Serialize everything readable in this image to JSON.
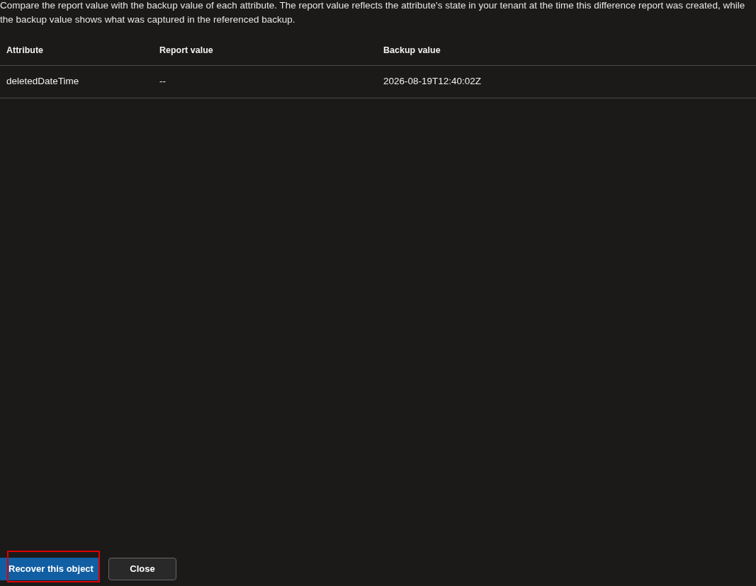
{
  "description": "Compare the report value with the backup value of each attribute. The report value reflects the attribute's state in your tenant at the time this difference report was created, while the backup value shows what was captured in the referenced backup.",
  "table": {
    "columns": [
      "Attribute",
      "Report value",
      "Backup value"
    ],
    "rows": [
      [
        "deletedDateTime",
        "--",
        "2026-08-19T12:40:02Z"
      ]
    ]
  },
  "buttons": [
    {
      "label": "Recover this object",
      "kind": "primary",
      "highlighted": true
    },
    {
      "label": "Close",
      "kind": "secondary",
      "highlighted": false
    }
  ]
}
